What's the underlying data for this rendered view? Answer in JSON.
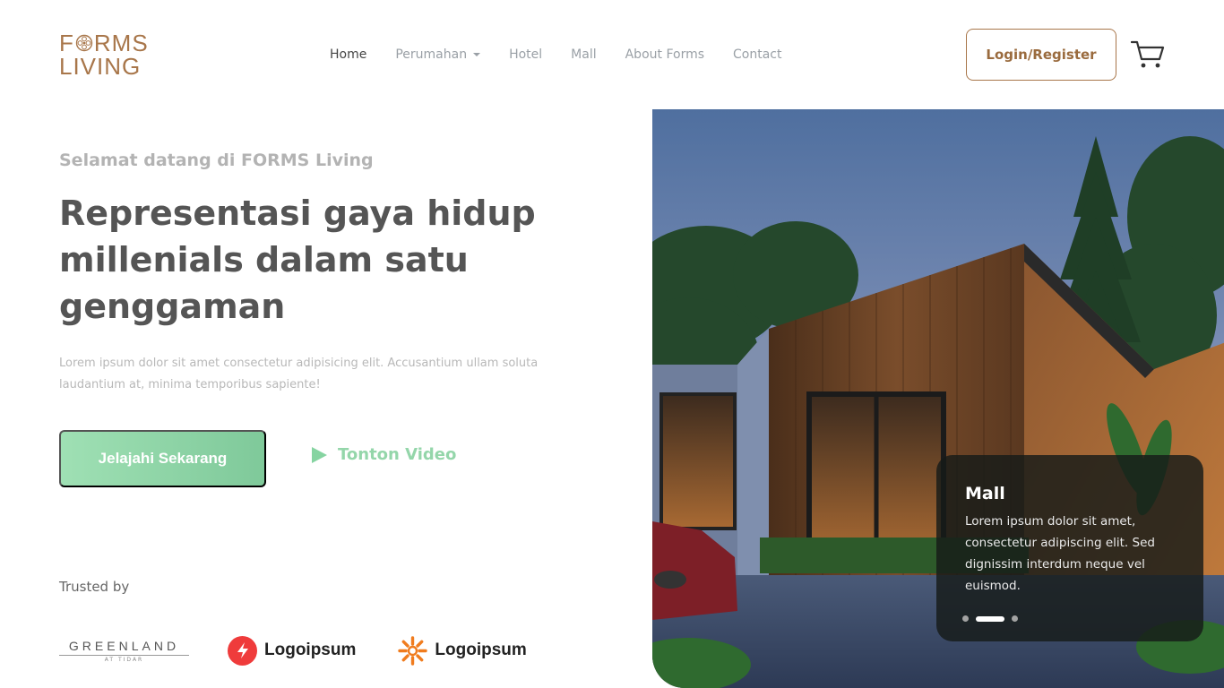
{
  "brand": {
    "line1_a": "F",
    "line1_b": "RMS",
    "line2": "LIVING",
    "color": "#a8764a"
  },
  "nav": {
    "items": [
      {
        "label": "Home",
        "active": true
      },
      {
        "label": "Perumahan",
        "dropdown": true
      },
      {
        "label": "Hotel"
      },
      {
        "label": "Mall"
      },
      {
        "label": "About Forms"
      },
      {
        "label": "Contact"
      }
    ]
  },
  "header": {
    "login_label": "Login/Register",
    "cart_icon": "shopping-cart-icon"
  },
  "hero": {
    "eyebrow": "Selamat datang di FORMS Living",
    "headline": "Representasi gaya hidup millenials dalam satu genggaman",
    "lead": "Lorem ipsum dolor sit amet consectetur adipisicing elit. Accusantium ullam soluta laudantium at, minima temporibus sapiente!",
    "cta_label": "Jelajahi Sekarang",
    "video_label": "Tonton Video",
    "accent": "#86d4a1"
  },
  "trusted": {
    "label": "Trusted by",
    "partners": [
      {
        "name": "GREENLAND",
        "sub": "AT TIDAR"
      },
      {
        "name": "Logoipsum",
        "icon": "bolt-icon"
      },
      {
        "name": "Logoipsum",
        "icon": "sunburst-icon"
      }
    ]
  },
  "slide": {
    "title": "Mall",
    "text": "Lorem ipsum dolor sit amet, consectetur adipiscing elit. Sed dignissim interdum neque vel euismod.",
    "dots": [
      false,
      true,
      false
    ]
  }
}
